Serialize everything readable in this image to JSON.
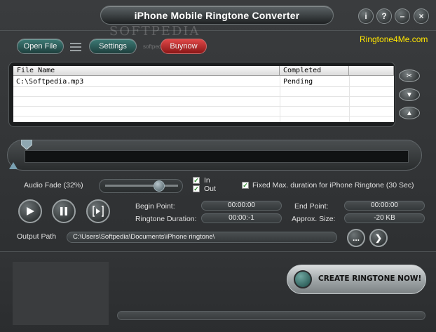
{
  "window": {
    "title": "iPhone Mobile Ringtone Converter",
    "buttons": {
      "info": "i",
      "help": "?",
      "minimize": "–",
      "close": "×"
    }
  },
  "watermark": {
    "main": "SOFTPEDIA",
    "small": "softpedia"
  },
  "toolbar": {
    "open_file": "Open File",
    "settings": "Settings",
    "buynow": "Buynow",
    "brand_link": "Ringtone4Me.com"
  },
  "file_table": {
    "columns": [
      "File Name",
      "Completed"
    ],
    "rows": [
      {
        "file_name": "C:\\Softpedia.mp3",
        "completed": "Pending"
      }
    ]
  },
  "side_buttons": {
    "remove": "✂",
    "down": "▼",
    "up": "▲"
  },
  "audio_fade": {
    "label": "Audio Fade (32%)",
    "percent": 32
  },
  "fade_options": {
    "in_label": "In",
    "in_checked": true,
    "out_label": "Out",
    "out_checked": true
  },
  "fixed_duration": {
    "label": "Fixed Max. duration for iPhone Ringtone (30 Sec)",
    "checked": true
  },
  "points": {
    "begin_label": "Begin Point:",
    "begin_value": "00:00:00",
    "end_label": "End Point:",
    "end_value": "00:00:00",
    "duration_label": "Ringtone Duration:",
    "duration_value": "00:00:-1",
    "size_label": "Approx. Size:",
    "size_value": "-20 KB"
  },
  "output": {
    "label": "Output Path",
    "path": "C:\\Users\\Softpedia\\Documents\\iPhone ringtone\\",
    "browse": "...",
    "go": "❯"
  },
  "create_button": {
    "label": "CREATE RINGTONE NOW!"
  },
  "colors": {
    "accent": "#ffe600",
    "buynow": "#c62828",
    "pill": "#2f5f5b"
  },
  "icons": [
    "info-icon",
    "help-icon",
    "minimize-icon",
    "close-icon",
    "menu-icon",
    "scissors-icon",
    "arrow-down-icon",
    "arrow-up-icon",
    "play-icon",
    "pause-icon",
    "step-icon",
    "chevron-right-icon"
  ]
}
